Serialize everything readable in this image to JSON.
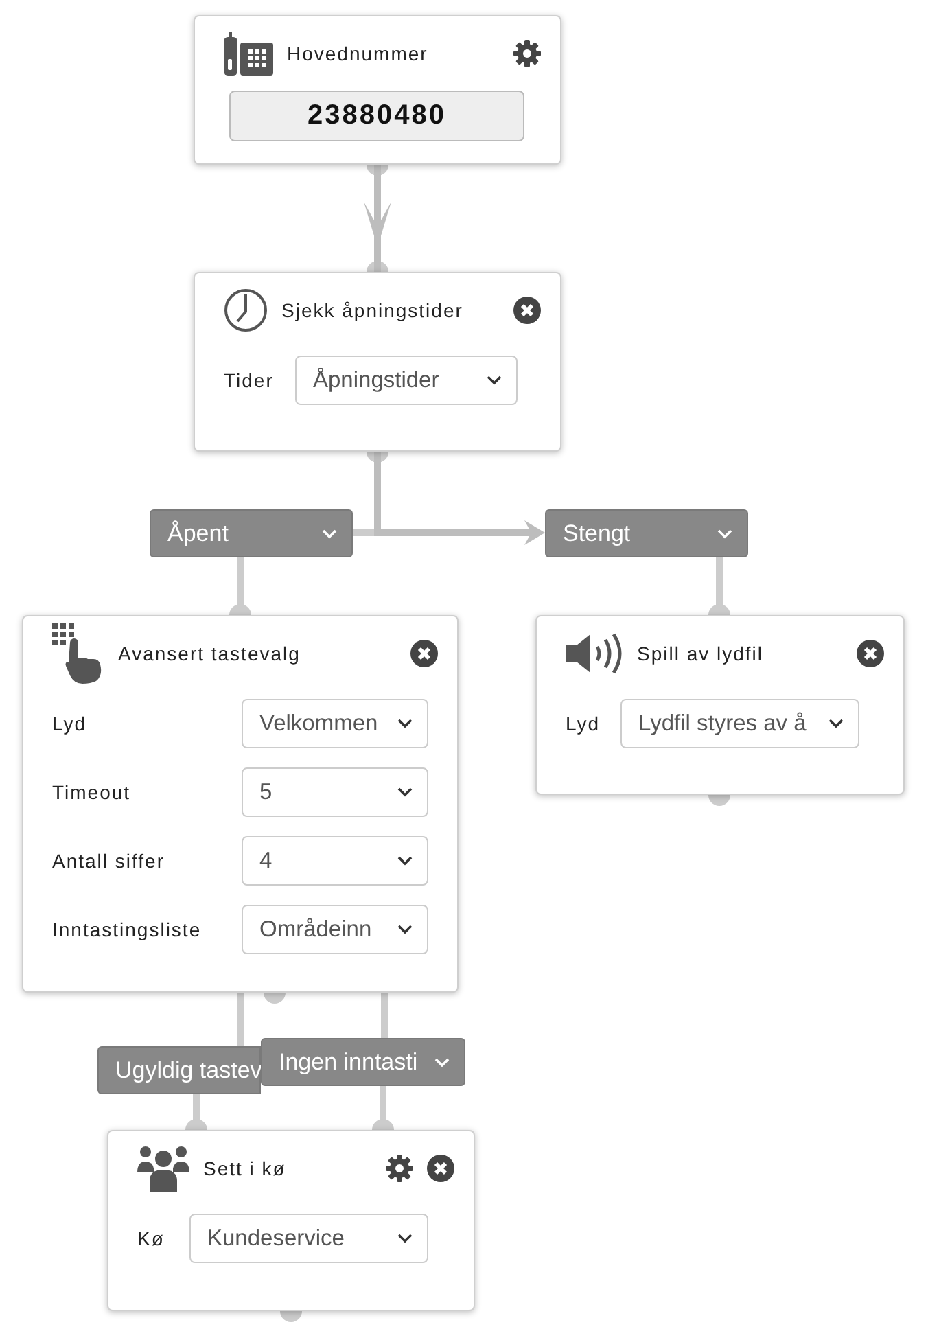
{
  "nodes": [
    {
      "kind": "number",
      "title": "Hovednummer",
      "settings": true,
      "removable": false,
      "number": "23880480"
    },
    {
      "kind": "schedule",
      "title": "Sjekk åpningstider",
      "settings": false,
      "removable": true,
      "fields": [
        {
          "label": "Tider",
          "value": "Åpningstider"
        }
      ]
    },
    {
      "kind": "menu",
      "title": "Avansert tastevalg",
      "settings": false,
      "removable": true,
      "fields": [
        {
          "label": "Lyd",
          "value": "Velkommen"
        },
        {
          "label": "Timeout",
          "value": "5"
        },
        {
          "label": "Antall siffer",
          "value": "4"
        },
        {
          "label": "Inntastingsliste",
          "value": "Områdeinn"
        }
      ]
    },
    {
      "kind": "playback",
      "title": "Spill av lydfil",
      "settings": false,
      "removable": true,
      "fields": [
        {
          "label": "Lyd",
          "value": "Lydfil styres av å"
        }
      ]
    },
    {
      "kind": "queue",
      "title": "Sett i kø",
      "settings": true,
      "removable": true,
      "fields": [
        {
          "label": "Kø",
          "value": "Kundeservice"
        }
      ]
    }
  ],
  "branches": [
    {
      "label": "Åpent"
    },
    {
      "label": "Stengt"
    },
    {
      "label": "Ugyldig tastev"
    },
    {
      "label": "Ingen inntasti"
    }
  ]
}
